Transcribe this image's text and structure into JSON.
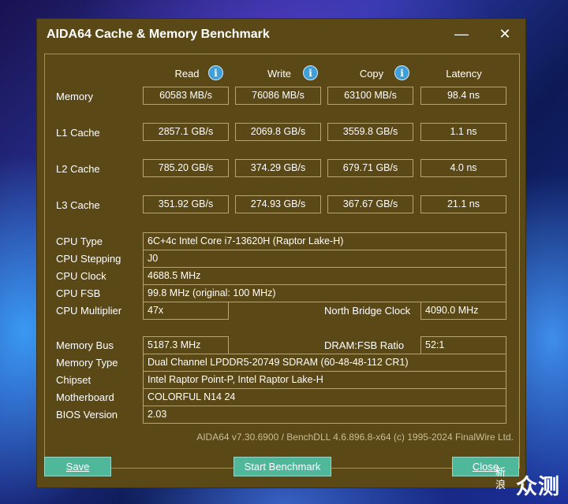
{
  "window": {
    "title": "AIDA64 Cache & Memory Benchmark",
    "minimize_glyph": "—",
    "close_glyph": "✕"
  },
  "columns": {
    "read": "Read",
    "write": "Write",
    "copy": "Copy",
    "latency": "Latency",
    "info_glyph": "i"
  },
  "rows": [
    {
      "label": "Memory",
      "read": "60583 MB/s",
      "write": "76086 MB/s",
      "copy": "63100 MB/s",
      "latency": "98.4 ns"
    },
    {
      "label": "L1 Cache",
      "read": "2857.1 GB/s",
      "write": "2069.8 GB/s",
      "copy": "3559.8 GB/s",
      "latency": "1.1 ns"
    },
    {
      "label": "L2 Cache",
      "read": "785.20 GB/s",
      "write": "374.29 GB/s",
      "copy": "679.71 GB/s",
      "latency": "4.0 ns"
    },
    {
      "label": "L3 Cache",
      "read": "351.92 GB/s",
      "write": "274.93 GB/s",
      "copy": "367.67 GB/s",
      "latency": "21.1 ns"
    }
  ],
  "cpu": {
    "type_label": "CPU Type",
    "type_value": "6C+4c Intel Core i7-13620H  (Raptor Lake-H)",
    "stepping_label": "CPU Stepping",
    "stepping_value": "J0",
    "clock_label": "CPU Clock",
    "clock_value": "4688.5 MHz",
    "fsb_label": "CPU FSB",
    "fsb_value": "99.8 MHz  (original: 100 MHz)",
    "multiplier_label": "CPU Multiplier",
    "multiplier_value": "47x",
    "nb_clock_label": "North Bridge Clock",
    "nb_clock_value": "4090.0 MHz"
  },
  "memory": {
    "bus_label": "Memory Bus",
    "bus_value": "5187.3 MHz",
    "ratio_label": "DRAM:FSB Ratio",
    "ratio_value": "52:1",
    "type_label": "Memory Type",
    "type_value": "Dual Channel LPDDR5-20749 SDRAM  (60-48-48-112 CR1)",
    "chipset_label": "Chipset",
    "chipset_value": "Intel Raptor Point-P, Intel Raptor Lake-H",
    "motherboard_label": "Motherboard",
    "motherboard_value": "COLORFUL N14 24",
    "bios_label": "BIOS Version",
    "bios_value": "2.03"
  },
  "footer": "AIDA64 v7.30.6900 / BenchDLL 4.6.896.8-x64  (c) 1995-2024 FinalWire Ltd.",
  "buttons": {
    "save": "Save",
    "start": "Start Benchmark",
    "close": "Close"
  },
  "watermark": {
    "small_top": "新",
    "small_bottom": "浪",
    "big": "众测"
  },
  "colors": {
    "window_bg": "#5a4817",
    "button_bg": "#4fb79a",
    "info_icon": "#3f9fd6"
  }
}
